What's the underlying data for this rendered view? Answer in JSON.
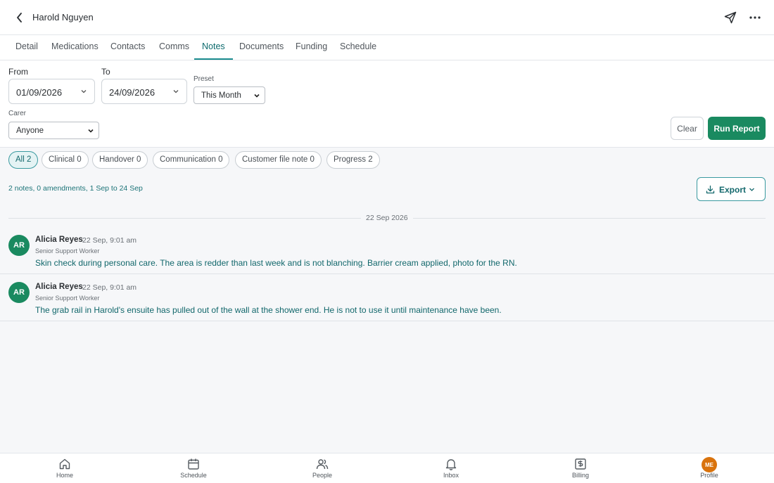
{
  "header": {
    "title": "Harold Nguyen"
  },
  "tabs": [
    {
      "label": "Detail"
    },
    {
      "label": "Medications"
    },
    {
      "label": "Contacts"
    },
    {
      "label": "Comms"
    },
    {
      "label": "Notes"
    },
    {
      "label": "Documents"
    },
    {
      "label": "Funding"
    },
    {
      "label": "Schedule"
    }
  ],
  "active_tab": "Notes",
  "filters": {
    "from_label": "From",
    "from_value": "01/09/2026",
    "to_label": "To",
    "to_value": "24/09/2026",
    "preset_label": "Preset",
    "preset_value": "This Month",
    "carer_label": "Carer",
    "carer_value": "Anyone",
    "clear_label": "Clear",
    "run_label": "Run Report"
  },
  "chips": [
    {
      "label": "All 2",
      "active": true
    },
    {
      "label": "Clinical 0"
    },
    {
      "label": "Handover 0"
    },
    {
      "label": "Communication 0"
    },
    {
      "label": "Customer file note 0"
    },
    {
      "label": "Progress 2"
    }
  ],
  "summary": "2 notes, 0 amendments, 1 Sep to 24 Sep",
  "export_label": "Export",
  "date_group": "22 Sep 2026",
  "notes": [
    {
      "initials": "AR",
      "author": "Alicia Reyes",
      "time": "22 Sep, 9:01 am",
      "role": "Senior Support Worker",
      "text": "Skin check during personal care. The area is redder than last week and is not blanching. Barrier cream applied, photo for the RN."
    },
    {
      "initials": "AR",
      "author": "Alicia Reyes",
      "time": "22 Sep, 9:01 am",
      "role": "Senior Support Worker",
      "text": "The grab rail in Harold's ensuite has pulled out of the wall at the shower end. He is not to use it until maintenance have been."
    }
  ],
  "bottom_nav": [
    {
      "label": "Home",
      "icon": "home-icon"
    },
    {
      "label": "Schedule",
      "icon": "calendar-icon"
    },
    {
      "label": "People",
      "icon": "people-icon"
    },
    {
      "label": "Inbox",
      "icon": "bell-icon"
    },
    {
      "label": "Billing",
      "icon": "billing-icon"
    },
    {
      "label": "Profile",
      "icon": "profile-avatar",
      "badge": "ME"
    }
  ],
  "colors": {
    "accent": "#1a8c8f",
    "primary_button": "#1a8a60",
    "avatar": "#1a8a60",
    "profile_badge": "#d9730d"
  }
}
